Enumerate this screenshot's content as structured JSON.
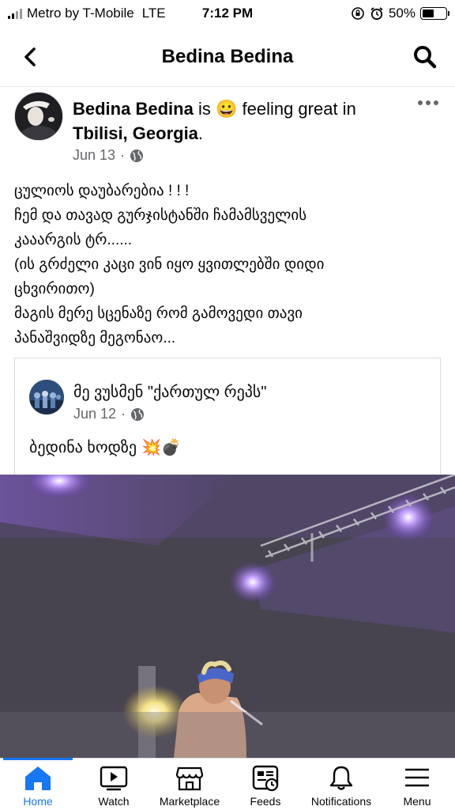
{
  "status": {
    "carrier": "Metro by T-Mobile",
    "network": "LTE",
    "time": "7:12 PM",
    "battery_percent": "50%",
    "battery_level": 0.5
  },
  "header": {
    "title": "Bedina Bedina"
  },
  "post": {
    "author": "Bedina Bedina",
    "is_text": "is",
    "emoji": "😀",
    "feeling_text": "feeling great in",
    "location": "Tbilisi, Georgia",
    "period": ".",
    "date": "Jun 13",
    "date_sep": "·",
    "body": [
      "ცულიოს დაუბარებია ! ! !",
      "ჩემ და თავად გურჯისტანში ჩამამსველის",
      "კააარგის ტრ......",
      "(ის გრძელი კაცი ვინ იყო ყვითლებში დიდი",
      "ცხვირითო)",
      "მაგის მერე სცენაზე რომ გამოვედი თავი",
      "პანაშვიდზე მეგონაო..."
    ]
  },
  "shared": {
    "page_name": "მე ვუსმენ \"ქართულ რეპს\"",
    "date": "Jun 12",
    "date_sep": "·",
    "text": "ბედინა ხოდზე",
    "emojis": "💥💣"
  },
  "tabs": [
    {
      "label": "Home",
      "icon": "home-icon"
    },
    {
      "label": "Watch",
      "icon": "watch-icon"
    },
    {
      "label": "Marketplace",
      "icon": "marketplace-icon"
    },
    {
      "label": "Feeds",
      "icon": "feeds-icon"
    },
    {
      "label": "Notifications",
      "icon": "notifications-icon"
    },
    {
      "label": "Menu",
      "icon": "menu-icon"
    }
  ],
  "colors": {
    "accent": "#1877f2",
    "secondary_text": "#65676b"
  }
}
